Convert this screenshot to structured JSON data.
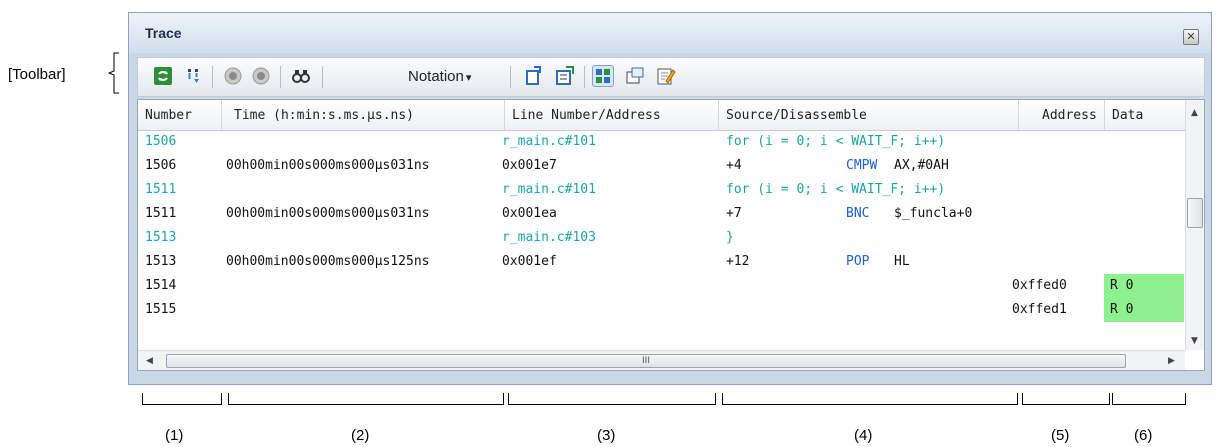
{
  "annotation": {
    "toolbar_label": "[Toolbar]",
    "area_numbers": [
      "(1)",
      "(2)",
      "(3)",
      "(4)",
      "(5)",
      "(6)"
    ]
  },
  "window": {
    "title": "Trace",
    "close_glyph": "✕"
  },
  "toolbar": {
    "notation_label": "Notation",
    "notation_caret": "▾",
    "icons": [
      "refresh-icon",
      "filter-icon",
      "record-stop-icon",
      "record-clear-icon",
      "find-icon",
      "jump-to-source-icon",
      "jump-to-disassemble-icon",
      "mix-display-icon",
      "window-lock-icon",
      "edit-icon"
    ]
  },
  "columns": [
    "Number",
    "Time (h:min:s.ms.μs.ns)",
    "Line Number/Address",
    "Source/Disassemble",
    "Address",
    "Data"
  ],
  "rows": [
    {
      "type": "source",
      "number": "1506",
      "time": "",
      "line": "r_main.c#101",
      "source": "for (i = 0; i < WAIT_F; i++)",
      "mnemonic": "",
      "operand": "",
      "address": "",
      "data": ""
    },
    {
      "type": "code",
      "number": "1506",
      "time": "00h00min00s000ms000μs031ns",
      "line": "0x001e7",
      "source": "+4",
      "mnemonic": "CMPW",
      "operand": "AX,#0AH",
      "address": "",
      "data": ""
    },
    {
      "type": "source",
      "number": "1511",
      "time": "",
      "line": "r_main.c#101",
      "source": "for (i = 0; i < WAIT_F; i++)",
      "mnemonic": "",
      "operand": "",
      "address": "",
      "data": ""
    },
    {
      "type": "code",
      "number": "1511",
      "time": "00h00min00s000ms000μs031ns",
      "line": "0x001ea",
      "source": "+7",
      "mnemonic": "BNC",
      "operand": "$_funcla+0",
      "address": "",
      "data": ""
    },
    {
      "type": "source",
      "number": "1513",
      "time": "",
      "line": "r_main.c#103",
      "source": "}",
      "mnemonic": "",
      "operand": "",
      "address": "",
      "data": ""
    },
    {
      "type": "code",
      "number": "1513",
      "time": "00h00min00s000ms000μs125ns",
      "line": "0x001ef",
      "source": "+12",
      "mnemonic": "POP",
      "operand": "HL",
      "address": "",
      "data": ""
    },
    {
      "type": "code",
      "number": "1514",
      "time": "",
      "line": "",
      "source": "",
      "mnemonic": "",
      "operand": "",
      "address": "0xffed0",
      "data": "R 0"
    },
    {
      "type": "code",
      "number": "1515",
      "time": "",
      "line": "",
      "source": "",
      "mnemonic": "",
      "operand": "",
      "address": "0xffed1",
      "data": "R 0"
    }
  ],
  "scroll": {
    "h_thumb_glyph": "III"
  },
  "colors": {
    "source_row": "#1aa5a5",
    "mnemonic": "#1a5de0",
    "data_highlight": "#8ef08e"
  }
}
